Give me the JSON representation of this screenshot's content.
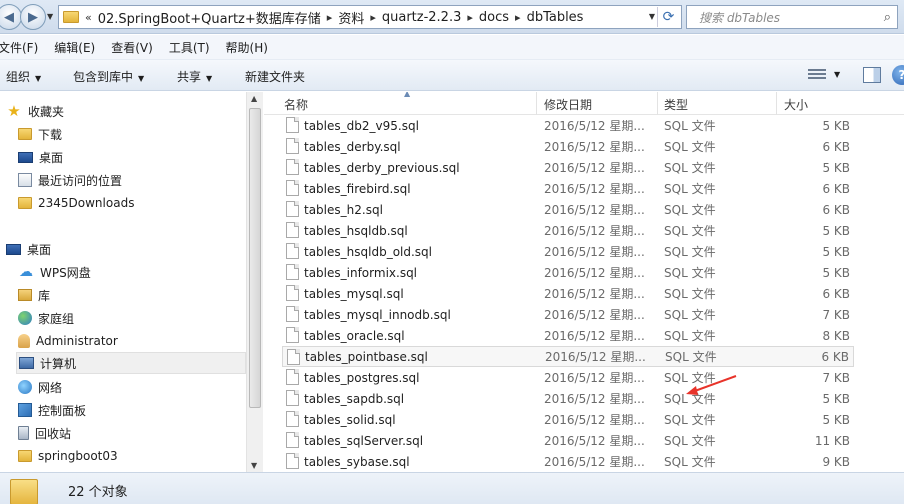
{
  "address": {
    "crumbs": [
      "«",
      "02.SpringBoot+Quartz+数据库存储",
      "资料",
      "quartz-2.2.3",
      "docs",
      "dbTables"
    ],
    "search_placeholder": "搜索 dbTables"
  },
  "menu": {
    "items": [
      "文件(F)",
      "编辑(E)",
      "查看(V)",
      "工具(T)",
      "帮助(H)"
    ]
  },
  "toolbar": {
    "organize": "组织",
    "include_library": "包含到库中",
    "share": "共享",
    "new_folder": "新建文件夹"
  },
  "sidebar": {
    "items": [
      {
        "label": "收藏夹",
        "icon": "star-icon"
      },
      {
        "label": "下载",
        "icon": "folder-icon"
      },
      {
        "label": "桌面",
        "icon": "desktop-icon"
      },
      {
        "label": "最近访问的位置",
        "icon": "recent-places-icon"
      },
      {
        "label": "2345Downloads",
        "icon": "folder-icon"
      },
      {
        "label": "桌面",
        "icon": "desktop-icon"
      },
      {
        "label": "WPS网盘",
        "icon": "cloud-icon"
      },
      {
        "label": "库",
        "icon": "library-icon"
      },
      {
        "label": "家庭组",
        "icon": "homegroup-icon"
      },
      {
        "label": "Administrator",
        "icon": "user-folder-icon"
      },
      {
        "label": "计算机",
        "icon": "computer-icon"
      },
      {
        "label": "网络",
        "icon": "network-icon"
      },
      {
        "label": "控制面板",
        "icon": "control-panel-icon"
      },
      {
        "label": "回收站",
        "icon": "recycle-bin-icon"
      },
      {
        "label": "springboot03",
        "icon": "folder-icon"
      }
    ]
  },
  "columns": {
    "name": "名称",
    "date": "修改日期",
    "type": "类型",
    "size": "大小"
  },
  "files": [
    {
      "name": "tables_db2_v95.sql",
      "date": "2016/5/12 星期...",
      "type": "SQL 文件",
      "size": "5 KB"
    },
    {
      "name": "tables_derby.sql",
      "date": "2016/5/12 星期...",
      "type": "SQL 文件",
      "size": "6 KB"
    },
    {
      "name": "tables_derby_previous.sql",
      "date": "2016/5/12 星期...",
      "type": "SQL 文件",
      "size": "5 KB"
    },
    {
      "name": "tables_firebird.sql",
      "date": "2016/5/12 星期...",
      "type": "SQL 文件",
      "size": "6 KB"
    },
    {
      "name": "tables_h2.sql",
      "date": "2016/5/12 星期...",
      "type": "SQL 文件",
      "size": "6 KB"
    },
    {
      "name": "tables_hsqldb.sql",
      "date": "2016/5/12 星期...",
      "type": "SQL 文件",
      "size": "5 KB"
    },
    {
      "name": "tables_hsqldb_old.sql",
      "date": "2016/5/12 星期...",
      "type": "SQL 文件",
      "size": "5 KB"
    },
    {
      "name": "tables_informix.sql",
      "date": "2016/5/12 星期...",
      "type": "SQL 文件",
      "size": "5 KB"
    },
    {
      "name": "tables_mysql.sql",
      "date": "2016/5/12 星期...",
      "type": "SQL 文件",
      "size": "6 KB"
    },
    {
      "name": "tables_mysql_innodb.sql",
      "date": "2016/5/12 星期...",
      "type": "SQL 文件",
      "size": "7 KB"
    },
    {
      "name": "tables_oracle.sql",
      "date": "2016/5/12 星期...",
      "type": "SQL 文件",
      "size": "8 KB"
    },
    {
      "name": "tables_pointbase.sql",
      "date": "2016/5/12 星期...",
      "type": "SQL 文件",
      "size": "6 KB"
    },
    {
      "name": "tables_postgres.sql",
      "date": "2016/5/12 星期...",
      "type": "SQL 文件",
      "size": "7 KB"
    },
    {
      "name": "tables_sapdb.sql",
      "date": "2016/5/12 星期...",
      "type": "SQL 文件",
      "size": "5 KB"
    },
    {
      "name": "tables_solid.sql",
      "date": "2016/5/12 星期...",
      "type": "SQL 文件",
      "size": "5 KB"
    },
    {
      "name": "tables_sqlServer.sql",
      "date": "2016/5/12 星期...",
      "type": "SQL 文件",
      "size": "11 KB"
    },
    {
      "name": "tables_sybase.sql",
      "date": "2016/5/12 星期...",
      "type": "SQL 文件",
      "size": "9 KB"
    }
  ],
  "status": {
    "count_text": "22 个对象"
  },
  "colors": {
    "annotation_arrow": "#e8332a",
    "selection_border": "#d9d9d9"
  }
}
